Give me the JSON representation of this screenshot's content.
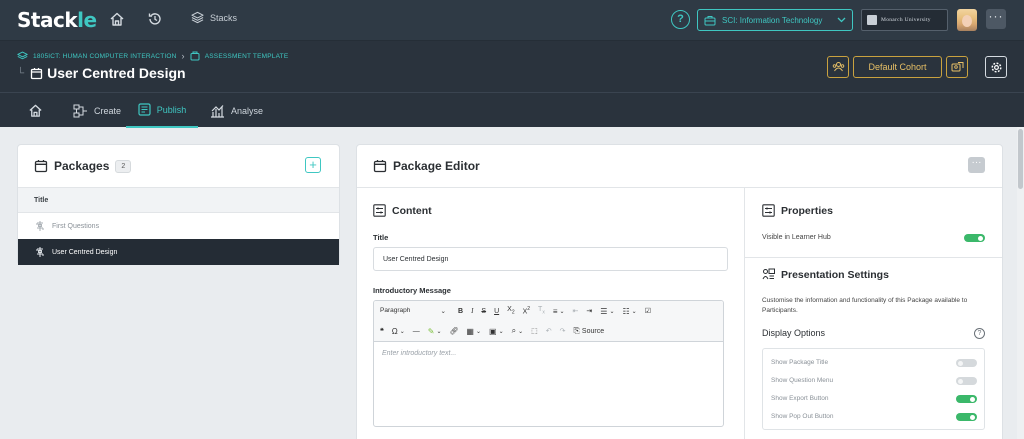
{
  "brand": {
    "logo_main": "Stack",
    "logo_tail": "le",
    "accent": "#3fc7c2"
  },
  "topbar": {
    "stacks_label": "Stacks",
    "help_label": "?",
    "course": "SCI: Information Technology",
    "university": "Monarch University",
    "more_label": "···"
  },
  "header": {
    "breadcrumb": [
      "1805ICT: HUMAN COMPUTER INTERACTION",
      "ASSESSMENT TEMPLATE"
    ],
    "title": "User Centred Design",
    "cohort_button": "Default Cohort"
  },
  "tabs": [
    {
      "label": "Create",
      "active": false
    },
    {
      "label": "Publish",
      "active": true
    },
    {
      "label": "Analyse",
      "active": false
    }
  ],
  "packages": {
    "title": "Packages",
    "count": "2",
    "add_label": "+",
    "column_title": "Title",
    "items": [
      {
        "label": "First Questions",
        "selected": false
      },
      {
        "label": "User Centred Design",
        "selected": true
      }
    ]
  },
  "editor": {
    "title": "Package Editor",
    "more_label": "···",
    "content": {
      "title": "Content",
      "title_label": "Title",
      "title_value": "User Centred Design",
      "intro_label": "Introductory Message",
      "intro_placeholder": "Enter introductory text...",
      "toolbar": {
        "paragraph": "Paragraph",
        "source": "Source"
      }
    },
    "properties": {
      "title": "Properties",
      "visible_label": "Visible in Learner Hub",
      "visible_on": true
    },
    "presentation": {
      "title": "Presentation Settings",
      "description": "Customise the information and functionality of this Package available to Participants.",
      "display_options_label": "Display Options",
      "help_label": "?",
      "options": [
        {
          "label": "Show Package Title",
          "on": false
        },
        {
          "label": "Show Question Menu",
          "on": false
        },
        {
          "label": "Show Export Button",
          "on": true
        },
        {
          "label": "Show Pop Out Button",
          "on": true
        }
      ]
    }
  }
}
